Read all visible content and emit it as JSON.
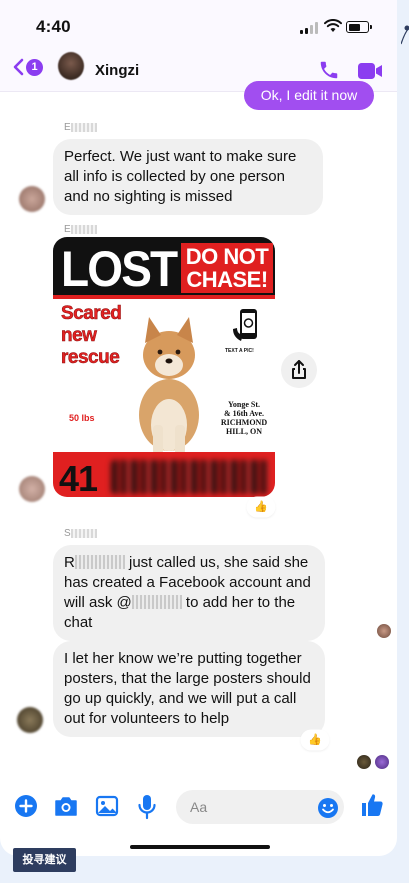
{
  "status_bar": {
    "time": "4:40",
    "signal_icon": "signal-bars-icon",
    "wifi_icon": "wifi-icon",
    "battery_icon": "battery-icon",
    "battery_level": 0.65
  },
  "header": {
    "back_icon": "chevron-left-icon",
    "back_badge": "1",
    "contact_name": "Xingzi",
    "call_icon": "phone-icon",
    "video_icon": "video-camera-icon",
    "accent": "#8b3df0"
  },
  "messages": {
    "sent_1": "Ok, I edit it now",
    "sender_1": "E",
    "received_1": "Perfect. We just want to make sure all info is collected by one person and no sighting is missed",
    "sender_2": "E",
    "sender_3": "S",
    "received_3_a": "R",
    "received_3_b": " just called us, she said she has created a Facebook account and will ask @",
    "received_3_c": " to add her to the chat",
    "received_4": "I let her know we’re putting together posters, that the large posters should go up quickly, and we will put a call out for volunteers to help",
    "reaction": "👍",
    "bubble_color": "#f0f0f0",
    "sent_color": "#a14ef0"
  },
  "poster": {
    "title": "LOST",
    "do_not": "DO NOT",
    "chase": "CHASE!",
    "scared": "Scared new rescue",
    "weight": "50 lbs",
    "text_pic": "TEXT A PIC!",
    "address_1": "Yonge St.",
    "address_2": "& 16th Ave.",
    "address_3": "RICHMOND",
    "address_4": "HILL, ON",
    "phone_prefix": "41",
    "red": "#e02020"
  },
  "composer": {
    "placeholder": "Aa",
    "icons": [
      "plus-circle-icon",
      "camera-icon",
      "image-icon",
      "microphone-icon",
      "emoji-icon",
      "thumbs-up-icon"
    ],
    "accent": "#1877f2"
  },
  "overlay": {
    "feedback": "投寻建议"
  }
}
